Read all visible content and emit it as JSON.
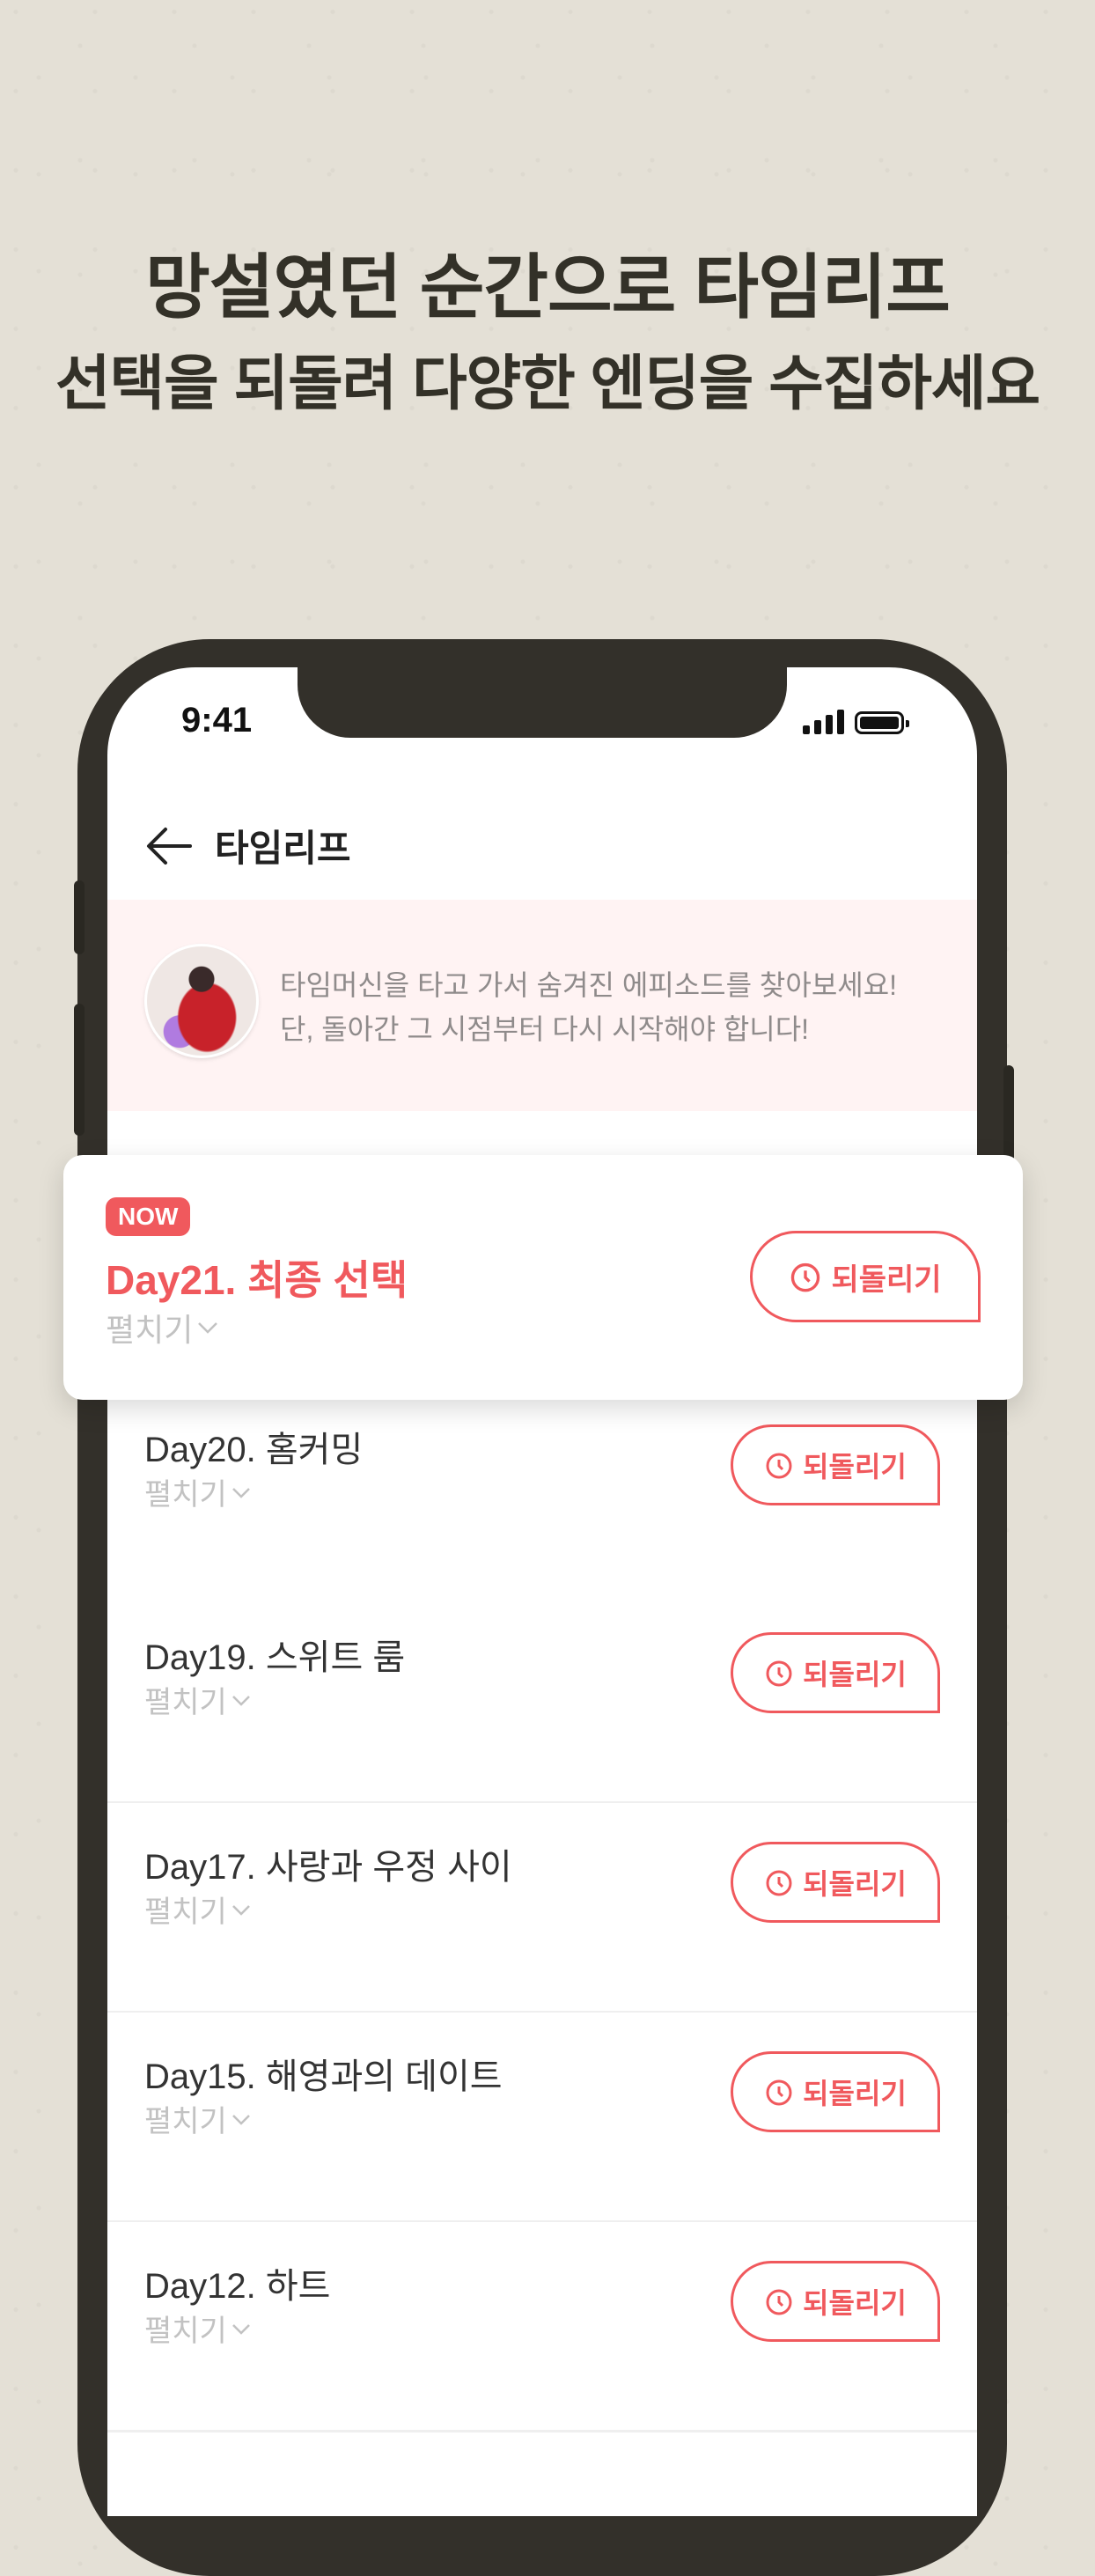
{
  "headline": {
    "line1": "망설였던 순간으로 타임리프",
    "line2": "선택을 되돌려 다양한 엔딩을 수집하세요"
  },
  "status_bar": {
    "time": "9:41"
  },
  "nav": {
    "title": "타임리프",
    "back_icon": "arrow-left-icon"
  },
  "banner": {
    "line1": "타임머신을 타고 가서 숨겨진 에피소드를 찾아보세요!",
    "line2": "단, 돌아간 그 시점부터 다시 시작해야 합니다!"
  },
  "current": {
    "badge": "NOW",
    "title": "Day21. 최종 선택",
    "expand": "펼치기",
    "button": "되돌리기"
  },
  "items": [
    {
      "title": "Day20. 홈커밍",
      "expand": "펼치기",
      "button": "되돌리기"
    },
    {
      "title": "Day19. 스위트 룸",
      "expand": "펼치기",
      "button": "되돌리기"
    },
    {
      "title": "Day17. 사랑과 우정 사이",
      "expand": "펼치기",
      "button": "되돌리기"
    },
    {
      "title": "Day15. 해영과의 데이트",
      "expand": "펼치기",
      "button": "되돌리기"
    },
    {
      "title": "Day12. 하트",
      "expand": "펼치기",
      "button": "되돌리기"
    }
  ],
  "colors": {
    "accent": "#f0595d",
    "background": "#e4e0d6",
    "phone_frame": "#33302a"
  }
}
